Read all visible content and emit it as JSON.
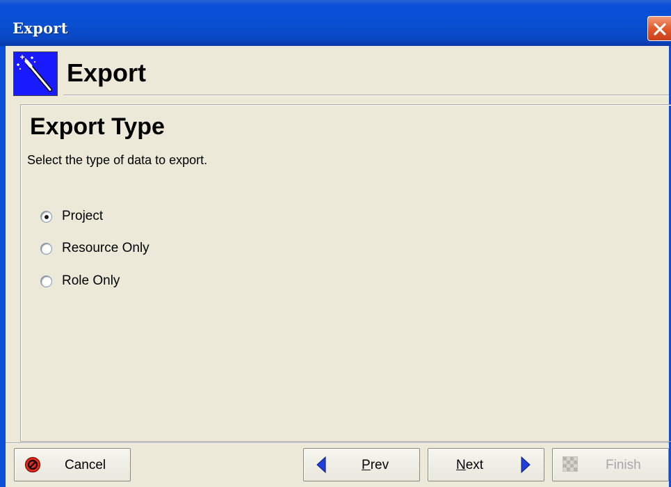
{
  "window": {
    "title": "Export",
    "colors": {
      "titlebar": "#0750d2",
      "close": "#e05a2c",
      "face": "#ece9d8"
    }
  },
  "header": {
    "title": "Export",
    "icon": "magic-wand-icon"
  },
  "page": {
    "title": "Export Type",
    "description": "Select the type of data to export."
  },
  "options": [
    {
      "label": "Project",
      "selected": true
    },
    {
      "label": "Resource Only",
      "selected": false
    },
    {
      "label": "Role Only",
      "selected": false
    }
  ],
  "buttons": {
    "cancel": {
      "label": "Cancel",
      "icon": "stop-icon",
      "enabled": true
    },
    "prev": {
      "mnemonic": "P",
      "rest": "rev",
      "icon": "arrow-left-icon",
      "enabled": true
    },
    "next": {
      "mnemonic": "N",
      "rest": "ext",
      "icon": "arrow-right-icon",
      "enabled": true
    },
    "finish": {
      "label": "Finish",
      "icon": "checkered-flag-icon",
      "enabled": false
    }
  }
}
